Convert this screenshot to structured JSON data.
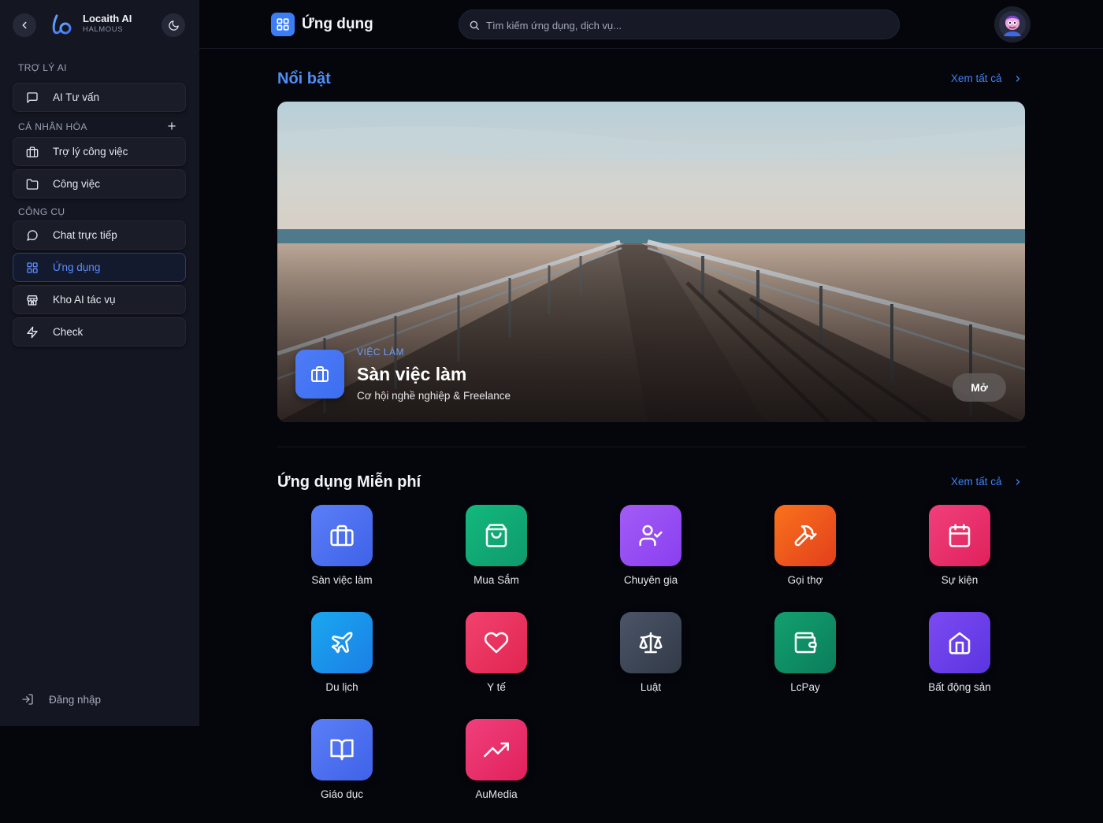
{
  "sidebar": {
    "brand_name": "Locaith AI",
    "brand_sub": "HALMOUS",
    "sections": {
      "ai_assistant": "TRỢ LÝ AI",
      "personalize": "CÁ NHÂN HÓA",
      "tools": "CÔNG CỤ"
    },
    "items": [
      {
        "label": "AI Tư vấn",
        "icon": "message-square-icon"
      },
      {
        "label": "Trợ lý công việc",
        "icon": "briefcase-icon"
      },
      {
        "label": "Công việc",
        "icon": "folder-icon"
      },
      {
        "label": "Chat trực tiếp",
        "icon": "message-circle-icon"
      },
      {
        "label": "Ứng dụng",
        "icon": "grid-icon",
        "active": true
      },
      {
        "label": "Kho AI tác vụ",
        "icon": "store-icon"
      },
      {
        "label": "Check",
        "icon": "zap-icon"
      }
    ],
    "login_label": "Đăng nhập"
  },
  "header": {
    "title": "Ứng dụng",
    "search_placeholder": "Tìm kiếm ứng dụng, dịch vụ..."
  },
  "featured": {
    "section_title": "Nổi bật",
    "see_all": "Xem tất cả",
    "category": "VIỆC LÀM",
    "title": "Sàn việc làm",
    "subtitle": "Cơ hội nghề nghiệp & Freelance",
    "open_label": "Mở"
  },
  "free_apps": {
    "section_title": "Ứng dụng Miễn phí",
    "see_all": "Xem tất cả",
    "apps": [
      {
        "label": "Sàn việc làm",
        "icon": "briefcase-icon"
      },
      {
        "label": "Mua Sắm",
        "icon": "shopping-bag-icon"
      },
      {
        "label": "Chuyên gia",
        "icon": "user-check-icon"
      },
      {
        "label": "Gọi thợ",
        "icon": "hammer-icon"
      },
      {
        "label": "Sự kiện",
        "icon": "calendar-icon"
      },
      {
        "label": "Du lịch",
        "icon": "plane-icon"
      },
      {
        "label": "Y tế",
        "icon": "heart-icon"
      },
      {
        "label": "Luật",
        "icon": "scale-icon"
      },
      {
        "label": "LcPay",
        "icon": "wallet-icon"
      },
      {
        "label": "Bất động sản",
        "icon": "home-icon"
      },
      {
        "label": "Giáo dục",
        "icon": "book-open-icon"
      },
      {
        "label": "AuMedia",
        "icon": "trending-up-icon"
      }
    ]
  },
  "colors": {
    "accent": "#3b82f6",
    "sidebar_bg": "#141621",
    "page_bg": "#05060c"
  }
}
